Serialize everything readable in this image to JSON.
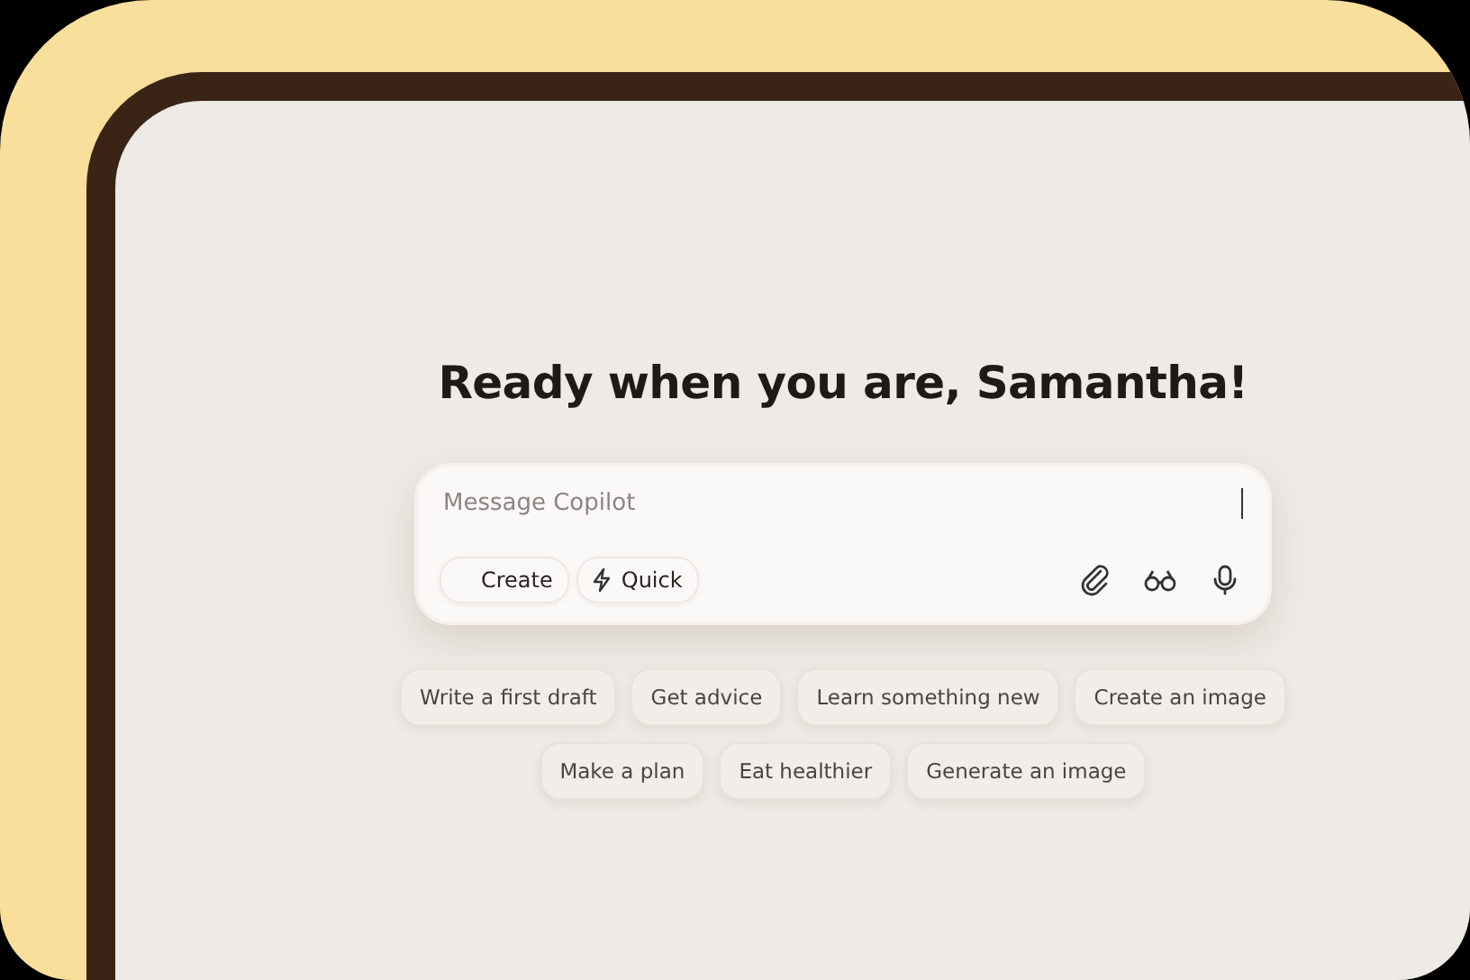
{
  "greeting": "Ready when you are, Samantha!",
  "composer": {
    "placeholder": "Message Copilot",
    "modes": [
      {
        "label": "Create",
        "kind": "plain"
      },
      {
        "label": "Quick",
        "kind": "bolt"
      }
    ]
  },
  "suggestions": [
    [
      "Write a first draft",
      "Get advice",
      "Learn something new",
      "Create an image"
    ],
    [
      "Make a plan",
      "Eat healthier",
      "Generate an image"
    ]
  ]
}
